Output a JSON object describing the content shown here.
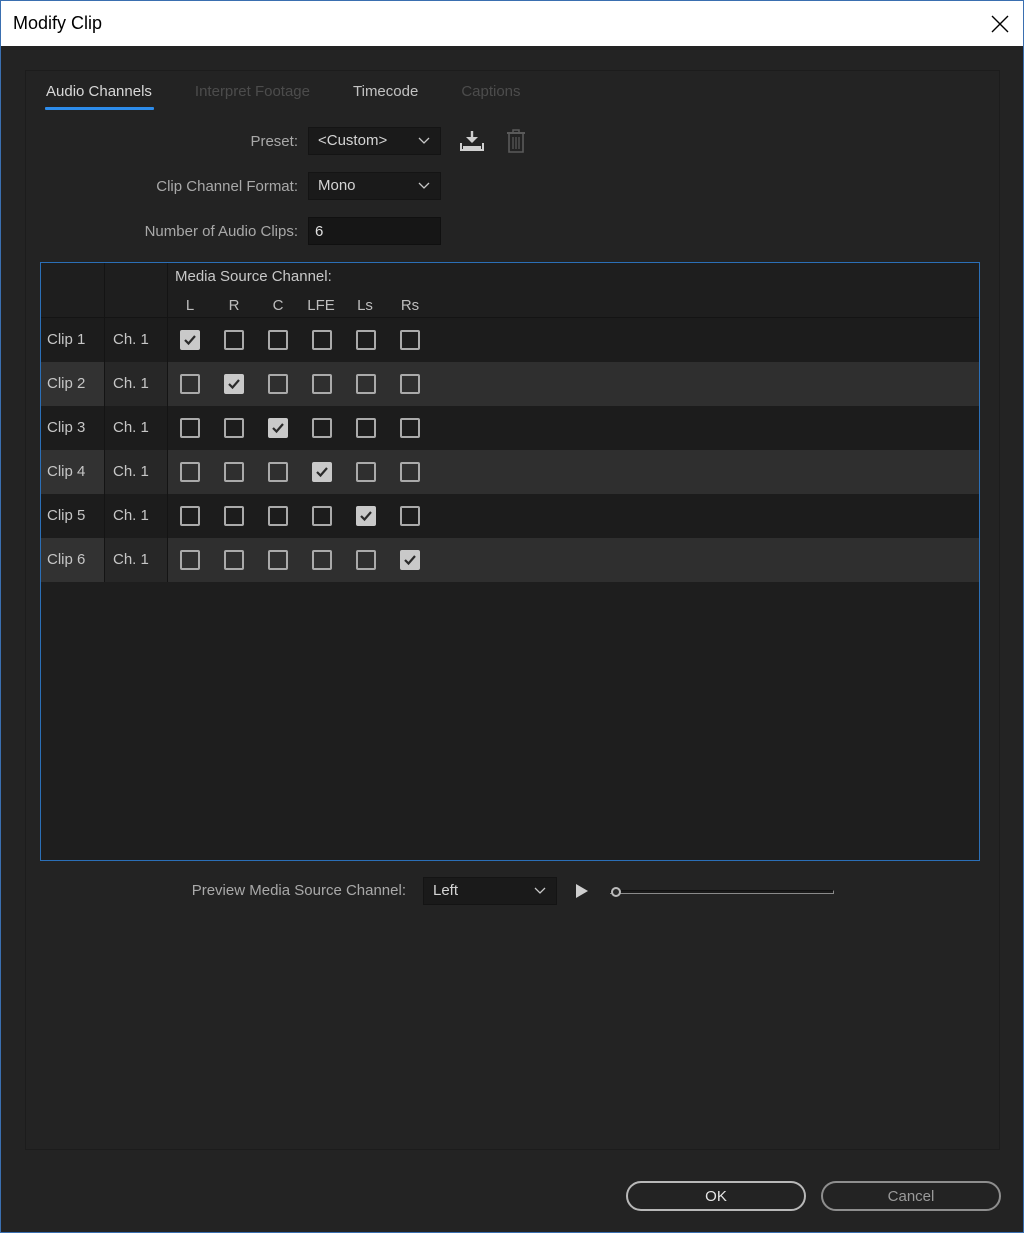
{
  "window": {
    "title": "Modify Clip"
  },
  "tabs": [
    {
      "label": "Audio Channels",
      "state": "active"
    },
    {
      "label": "Interpret Footage",
      "state": "disabled"
    },
    {
      "label": "Timecode",
      "state": "normal"
    },
    {
      "label": "Captions",
      "state": "disabled"
    }
  ],
  "form": {
    "preset_label": "Preset:",
    "preset_value": "<Custom>",
    "format_label": "Clip Channel Format:",
    "format_value": "Mono",
    "clips_label": "Number of Audio Clips:",
    "clips_value": "6"
  },
  "grid": {
    "media_source_label": "Media Source Channel:",
    "channels": [
      "L",
      "R",
      "C",
      "LFE",
      "Ls",
      "Rs"
    ],
    "rows": [
      {
        "clip": "Clip 1",
        "ch": "Ch. 1",
        "checked": [
          true,
          false,
          false,
          false,
          false,
          false
        ]
      },
      {
        "clip": "Clip 2",
        "ch": "Ch. 1",
        "checked": [
          false,
          true,
          false,
          false,
          false,
          false
        ]
      },
      {
        "clip": "Clip 3",
        "ch": "Ch. 1",
        "checked": [
          false,
          false,
          true,
          false,
          false,
          false
        ]
      },
      {
        "clip": "Clip 4",
        "ch": "Ch. 1",
        "checked": [
          false,
          false,
          false,
          true,
          false,
          false
        ]
      },
      {
        "clip": "Clip 5",
        "ch": "Ch. 1",
        "checked": [
          false,
          false,
          false,
          false,
          true,
          false
        ]
      },
      {
        "clip": "Clip 6",
        "ch": "Ch. 1",
        "checked": [
          false,
          false,
          false,
          false,
          false,
          true
        ]
      }
    ]
  },
  "preview": {
    "label": "Preview Media Source Channel:",
    "value": "Left",
    "position": 0
  },
  "buttons": {
    "ok": "OK",
    "cancel": "Cancel"
  },
  "colors": {
    "accent": "#2d8ceb",
    "background": "#232323"
  }
}
